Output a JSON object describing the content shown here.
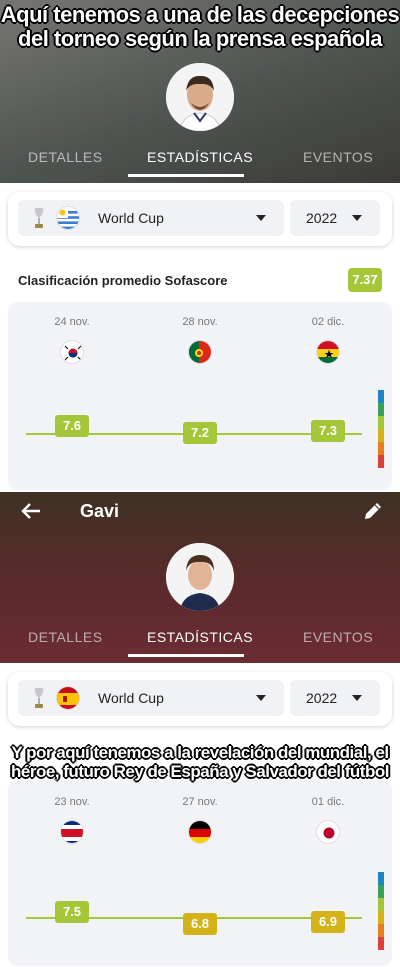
{
  "meme": {
    "top_line1": "Aquí tenemos a una de las decepciones",
    "top_line2": "del torneo según la prensa española",
    "middle_line1": "Y por aquí tenemos a la revelación del mundial, el",
    "middle_line2": "héroe, futuro Rey de España y Salvador del fútbol"
  },
  "panel1": {
    "header_gradient": [
      "#6b6a67",
      "#4e5350",
      "#3f3d3a"
    ],
    "tabs": [
      {
        "label": "DETALLES",
        "active": false
      },
      {
        "label": "ESTADÍSTICAS",
        "active": true
      },
      {
        "label": "EVENTOS",
        "active": false
      }
    ],
    "competition": "World Cup",
    "competition_flag_icon": "uruguay-flag-icon",
    "year": "2022",
    "rating_title": "Clasificación promedio Sofascore",
    "rating_average": "7.37",
    "matches": [
      {
        "date": "24 nov.",
        "opponent_flag": "south-korea-flag-icon",
        "rating": "7.6",
        "rating_color": "#a4c639"
      },
      {
        "date": "28 nov.",
        "opponent_flag": "portugal-flag-icon",
        "rating": "7.2",
        "rating_color": "#a4c639"
      },
      {
        "date": "02 dic.",
        "opponent_flag": "ghana-flag-icon",
        "rating": "7.3",
        "rating_color": "#a4c639"
      }
    ]
  },
  "panel2": {
    "player_name": "Gavi",
    "header_gradient": [
      "#4a3a2c",
      "#5a1e2e",
      "#6a2930"
    ],
    "tabs": [
      {
        "label": "DETALLES",
        "active": false
      },
      {
        "label": "ESTADÍSTICAS",
        "active": true
      },
      {
        "label": "EVENTOS",
        "active": false
      }
    ],
    "competition": "World Cup",
    "competition_flag_icon": "spain-flag-icon",
    "year": "2022",
    "matches": [
      {
        "date": "23 nov.",
        "opponent_flag": "costa-rica-flag-icon",
        "rating": "7.5",
        "rating_color": "#a4c639"
      },
      {
        "date": "27 nov.",
        "opponent_flag": "germany-flag-icon",
        "rating": "6.8",
        "rating_color": "#d4b21a"
      },
      {
        "date": "01 dic.",
        "opponent_flag": "japan-flag-icon",
        "rating": "6.9",
        "rating_color": "#d4b21a"
      }
    ]
  },
  "scale_colors": [
    "#1f86c2",
    "#3aa35a",
    "#a4c639",
    "#d4b21a",
    "#e67e22",
    "#d9413a"
  ]
}
